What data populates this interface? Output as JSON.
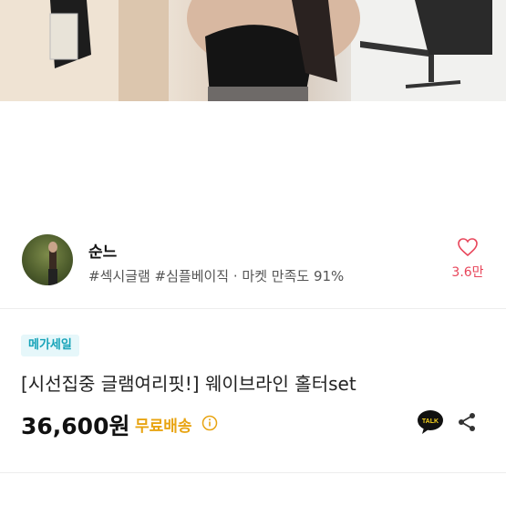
{
  "seller": {
    "name": "순느",
    "tags": "#섹시글램 #심플베이직 · 마켓 만족도 91%",
    "like_count": "3.6만"
  },
  "product": {
    "badge": "메가세일",
    "title": "[시선집중 글램여리핏!] 웨이브라인 홀터set",
    "price": "36,600원",
    "shipping": "무료배송"
  },
  "actions": {
    "talk_label": "TALK"
  },
  "colors": {
    "accent_pink": "#e8455a",
    "badge_bg": "#e6f7fa",
    "badge_text": "#16a3b8",
    "shipping": "#e8a412",
    "talk_yellow": "#111111"
  }
}
